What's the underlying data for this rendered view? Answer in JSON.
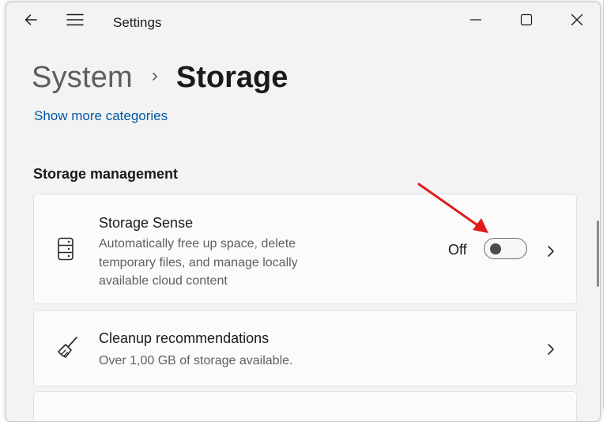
{
  "window": {
    "app_title": "Settings",
    "icons": {
      "back": "arrow-left-icon",
      "menu": "hamburger-icon",
      "minimize": "minimize-icon",
      "maximize": "maximize-icon",
      "close": "close-icon"
    }
  },
  "breadcrumb": {
    "parent": "System",
    "separator": "›",
    "current": "Storage"
  },
  "links": {
    "show_more": "Show more categories"
  },
  "section": {
    "heading": "Storage management"
  },
  "cards": {
    "storage_sense": {
      "icon": "storage-drive-icon",
      "title": "Storage Sense",
      "description": "Automatically free up space, delete temporary files, and manage locally available cloud content",
      "toggle_state_label": "Off",
      "toggle_on": false
    },
    "cleanup": {
      "icon": "broom-icon",
      "title": "Cleanup recommendations",
      "description": "Over 1,00 GB of storage available."
    }
  },
  "colors": {
    "link": "#0058a8",
    "annotation_arrow": "#e11b1b",
    "window_background": "#f3f3f3",
    "card_background": "#fbfbfb"
  }
}
